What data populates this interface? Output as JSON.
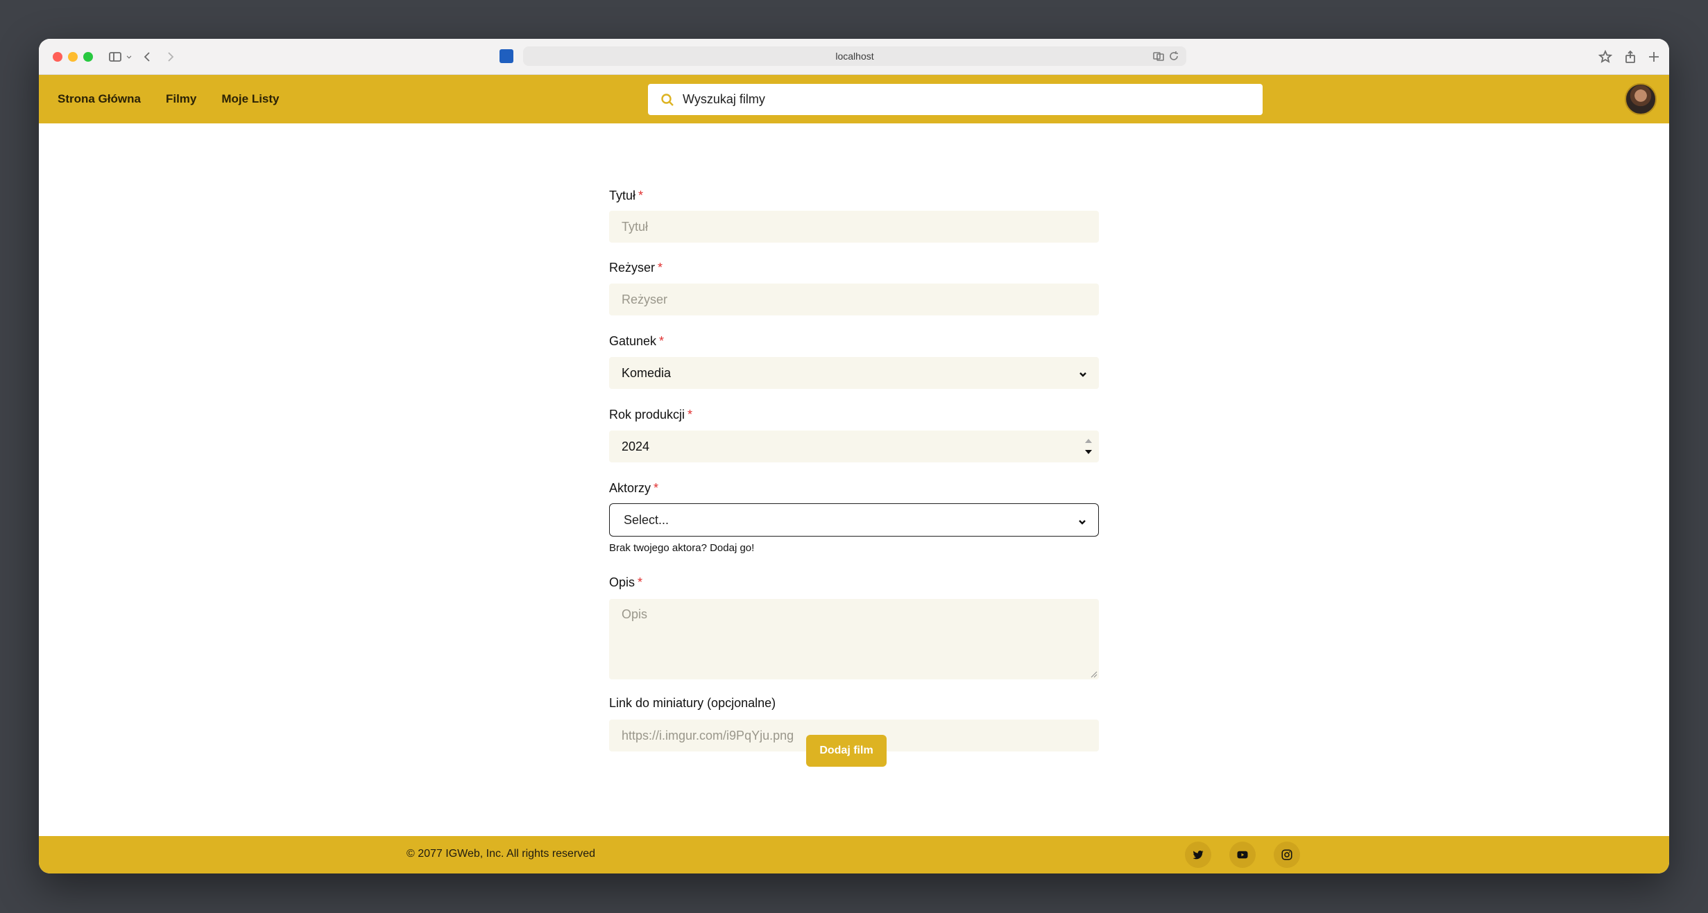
{
  "browser": {
    "url": "localhost"
  },
  "header": {
    "nav": [
      {
        "label": "Strona Główna"
      },
      {
        "label": "Filmy"
      },
      {
        "label": "Moje Listy"
      }
    ],
    "search_placeholder": "Wyszukaj filmy"
  },
  "form": {
    "title": {
      "label": "Tytuł",
      "required": "*",
      "placeholder": "Tytuł"
    },
    "director": {
      "label": "Reżyser",
      "required": "*",
      "placeholder": "Reżyser"
    },
    "genre": {
      "label": "Gatunek",
      "required": "*",
      "value": "Komedia"
    },
    "year": {
      "label": "Rok produkcji",
      "required": "*",
      "value": "2024"
    },
    "actors": {
      "label": "Aktorzy",
      "required": "*",
      "value": "Select...",
      "hint": "Brak twojego aktora? Dodaj go!"
    },
    "description": {
      "label": "Opis",
      "required": "*",
      "placeholder": "Opis"
    },
    "thumbnail": {
      "label": "Link do miniatury (opcjonalne)",
      "placeholder": "https://i.imgur.com/i9PqYju.png"
    },
    "submit_label": "Dodaj film"
  },
  "footer": {
    "copyright": "© 2077 IGWeb, Inc. All rights reserved",
    "socials": [
      "twitter-icon",
      "youtube-icon",
      "instagram-icon"
    ]
  },
  "colors": {
    "brand": "#ddb322",
    "input_bg": "#f8f6ec",
    "required": "#e03131"
  }
}
